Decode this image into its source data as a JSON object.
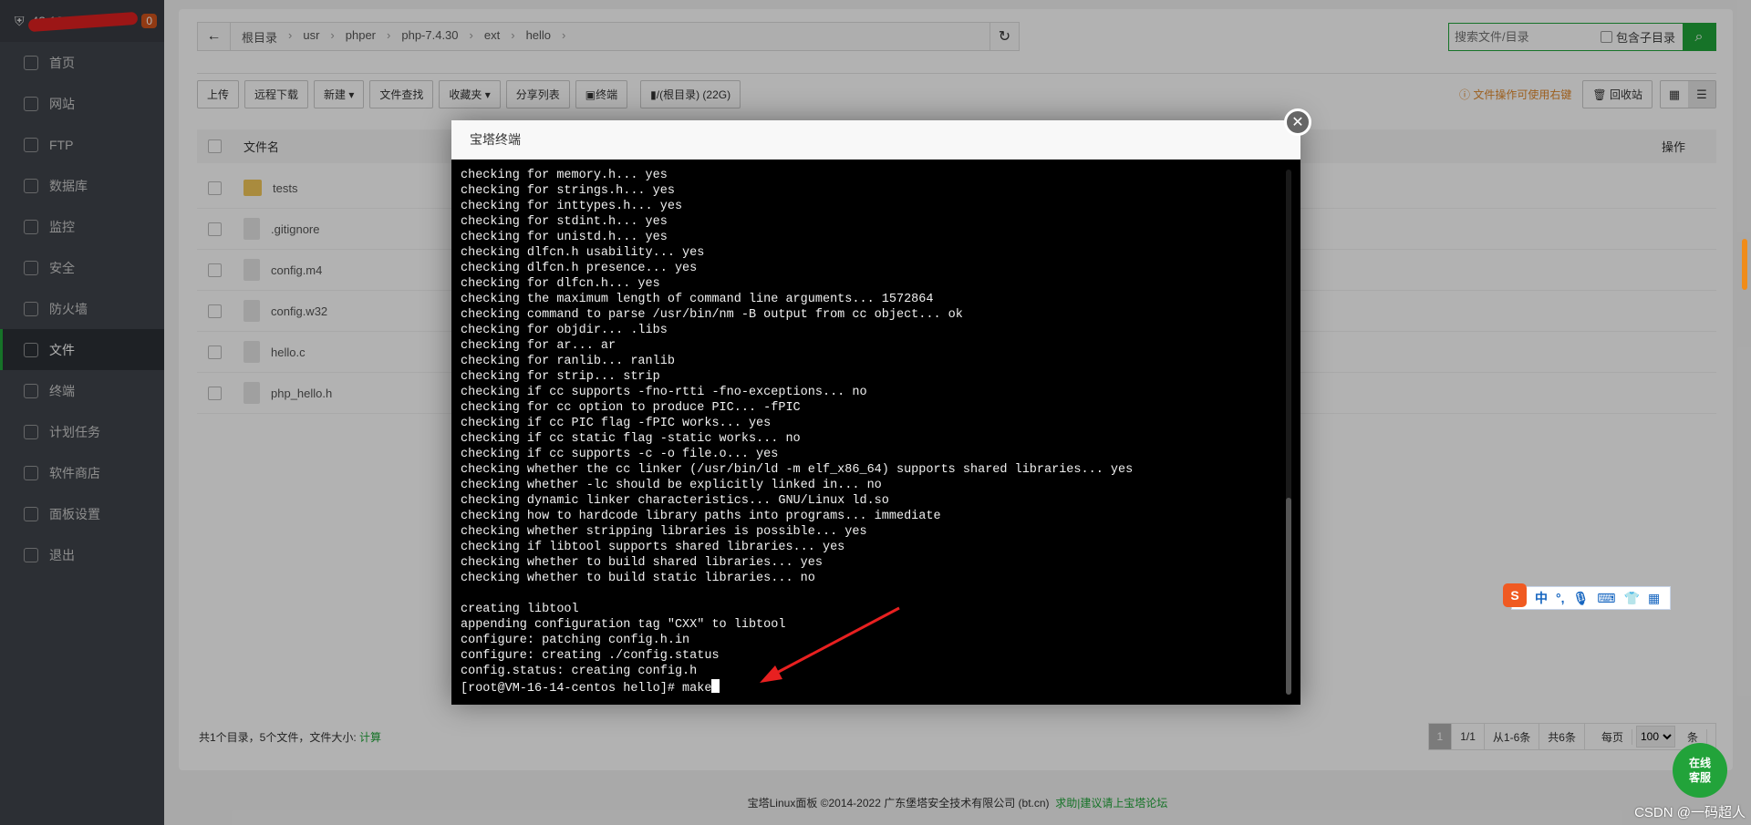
{
  "sidebar": {
    "server_ip": "43.138.*.*2",
    "badge": "0",
    "items": [
      {
        "label": "首页",
        "icon": "home-icon"
      },
      {
        "label": "网站",
        "icon": "globe-icon"
      },
      {
        "label": "FTP",
        "icon": "ftp-icon"
      },
      {
        "label": "数据库",
        "icon": "database-icon"
      },
      {
        "label": "监控",
        "icon": "monitor-icon"
      },
      {
        "label": "安全",
        "icon": "shield-icon"
      },
      {
        "label": "防火墙",
        "icon": "firewall-icon"
      },
      {
        "label": "文件",
        "icon": "folder-icon",
        "active": true
      },
      {
        "label": "终端",
        "icon": "terminal-icon"
      },
      {
        "label": "计划任务",
        "icon": "clock-icon"
      },
      {
        "label": "软件商店",
        "icon": "apps-icon"
      },
      {
        "label": "面板设置",
        "icon": "gear-icon"
      },
      {
        "label": "退出",
        "icon": "logout-icon"
      }
    ]
  },
  "breadcrumb": [
    "根目录",
    "usr",
    "phper",
    "php-7.4.30",
    "ext",
    "hello"
  ],
  "search": {
    "placeholder": "搜索文件/目录",
    "include_sub": "包含子目录"
  },
  "toolbar": [
    "上传",
    "远程下载",
    "新建 ▾",
    "文件查找",
    "收藏夹 ▾",
    "分享列表",
    "终端",
    "/(根目录) (22G)"
  ],
  "toolbar_right": {
    "hint": "文件操作可使用右键",
    "recycle": "回收站"
  },
  "table": {
    "col_name": "文件名",
    "col_ops": "操作",
    "rows": [
      {
        "name": "tests",
        "type": "dir"
      },
      {
        "name": ".gitignore",
        "type": "file"
      },
      {
        "name": "config.m4",
        "type": "file"
      },
      {
        "name": "config.w32",
        "type": "file"
      },
      {
        "name": "hello.c",
        "type": "file"
      },
      {
        "name": "php_hello.h",
        "type": "file"
      }
    ]
  },
  "summary": {
    "text": "共1个目录，5个文件，文件大小:",
    "calc": "计算"
  },
  "pager": {
    "current": "1",
    "pages": "1/1",
    "range": "从1-6条",
    "total": "共6条",
    "per_page_label": "每页",
    "per_page": "100",
    "unit": "条"
  },
  "footer": {
    "copyright": "宝塔Linux面板 ©2014-2022 广东堡塔安全技术有限公司 (bt.cn)",
    "links": "求助|建议请上宝塔论坛"
  },
  "modal": {
    "title": "宝塔终端",
    "lines": [
      "checking for memory.h... yes",
      "checking for strings.h... yes",
      "checking for inttypes.h... yes",
      "checking for stdint.h... yes",
      "checking for unistd.h... yes",
      "checking dlfcn.h usability... yes",
      "checking dlfcn.h presence... yes",
      "checking for dlfcn.h... yes",
      "checking the maximum length of command line arguments... 1572864",
      "checking command to parse /usr/bin/nm -B output from cc object... ok",
      "checking for objdir... .libs",
      "checking for ar... ar",
      "checking for ranlib... ranlib",
      "checking for strip... strip",
      "checking if cc supports -fno-rtti -fno-exceptions... no",
      "checking for cc option to produce PIC... -fPIC",
      "checking if cc PIC flag -fPIC works... yes",
      "checking if cc static flag -static works... no",
      "checking if cc supports -c -o file.o... yes",
      "checking whether the cc linker (/usr/bin/ld -m elf_x86_64) supports shared libraries... yes",
      "checking whether -lc should be explicitly linked in... no",
      "checking dynamic linker characteristics... GNU/Linux ld.so",
      "checking how to hardcode library paths into programs... immediate",
      "checking whether stripping libraries is possible... yes",
      "checking if libtool supports shared libraries... yes",
      "checking whether to build shared libraries... yes",
      "checking whether to build static libraries... no",
      "",
      "creating libtool",
      "appending configuration tag \"CXX\" to libtool",
      "configure: patching config.h.in",
      "configure: creating ./config.status",
      "config.status: creating config.h"
    ],
    "prompt": "[root@VM-16-14-centos hello]# make"
  },
  "ime": {
    "lang": "中",
    "punct": "°,"
  },
  "online_service": [
    "在线",
    "客服"
  ],
  "watermark": "CSDN @一码超人",
  "colors": {
    "accent": "#20a53a",
    "arrow": "#e82020",
    "hint": "#e08a2e"
  }
}
